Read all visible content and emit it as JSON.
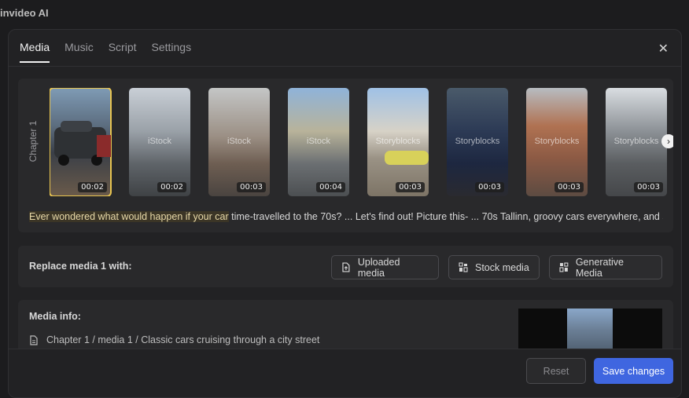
{
  "app": {
    "title": "invideo AI"
  },
  "tabs": [
    {
      "label": "Media",
      "active": true
    },
    {
      "label": "Music",
      "active": false
    },
    {
      "label": "Script",
      "active": false
    },
    {
      "label": "Settings",
      "active": false
    }
  ],
  "close_icon": "close-icon",
  "chapter": {
    "label": "Chapter 1"
  },
  "thumbnails": [
    {
      "duration": "00:02",
      "watermark": "",
      "selected": true
    },
    {
      "duration": "00:02",
      "watermark": "iStock",
      "selected": false
    },
    {
      "duration": "00:03",
      "watermark": "iStock",
      "selected": false
    },
    {
      "duration": "00:04",
      "watermark": "iStock",
      "selected": false
    },
    {
      "duration": "00:03",
      "watermark": "Storyblocks",
      "selected": false
    },
    {
      "duration": "00:03",
      "watermark": "Storyblocks",
      "selected": false
    },
    {
      "duration": "00:03",
      "watermark": "Storyblocks",
      "selected": false
    },
    {
      "duration": "00:03",
      "watermark": "Storyblocks",
      "selected": false
    }
  ],
  "script": {
    "highlighted": "Ever wondered what would happen if your car",
    "rest": " time-travelled to the 70s? ... Let's find out! Picture this- ... 70s Tallinn, groovy cars everywhere, and suc"
  },
  "replace": {
    "label": "Replace media 1 with:",
    "buttons": {
      "uploaded": "Uploaded media",
      "stock": "Stock media",
      "generative": "Generative Media"
    }
  },
  "media_info": {
    "label": "Media info:",
    "line": "Chapter 1 / media 1 / Classic cars cruising through a city street"
  },
  "footer": {
    "reset": "Reset",
    "save": "Save changes"
  },
  "colors": {
    "accent": "#3f66e0",
    "selection": "#e8c450",
    "highlight_bg": "#3b3526"
  }
}
